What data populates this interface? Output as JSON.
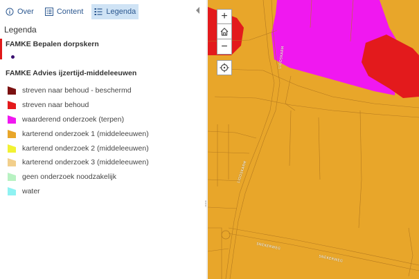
{
  "tabs": [
    {
      "label": "Over"
    },
    {
      "label": "Content"
    },
    {
      "label": "Legenda"
    }
  ],
  "legend": {
    "title": "Legenda",
    "layers": [
      {
        "title": "FAMKE Bepalen dorpskern"
      },
      {
        "title": "FAMKE Advies ijzertijd-middeleeuwen",
        "items": [
          {
            "label": "streven naar behoud - beschermd",
            "color": "#7b1111"
          },
          {
            "label": "streven naar behoud",
            "color": "#e31a1c"
          },
          {
            "label": "waarderend onderzoek (terpen)",
            "color": "#f018f0"
          },
          {
            "label": "karterend onderzoek 1 (middeleeuwen)",
            "color": "#e8a62a"
          },
          {
            "label": "karterend onderzoek 2 (middeleeuwen)",
            "color": "#f2f233"
          },
          {
            "label": "karterend onderzoek 3 (middeleeuwen)",
            "color": "#f2cf8c"
          },
          {
            "label": "geen onderzoek noodzakelijk",
            "color": "#b8f2c2"
          },
          {
            "label": "water",
            "color": "#8ff2f2"
          }
        ]
      }
    ]
  },
  "map": {
    "controls": {
      "zoom_in": "+",
      "zoom_out": "−"
    },
    "road_labels": [
      "LIOOSKARM",
      "LIOOSKARM",
      "SNEKERWEG",
      "SNEKERWEG"
    ]
  }
}
